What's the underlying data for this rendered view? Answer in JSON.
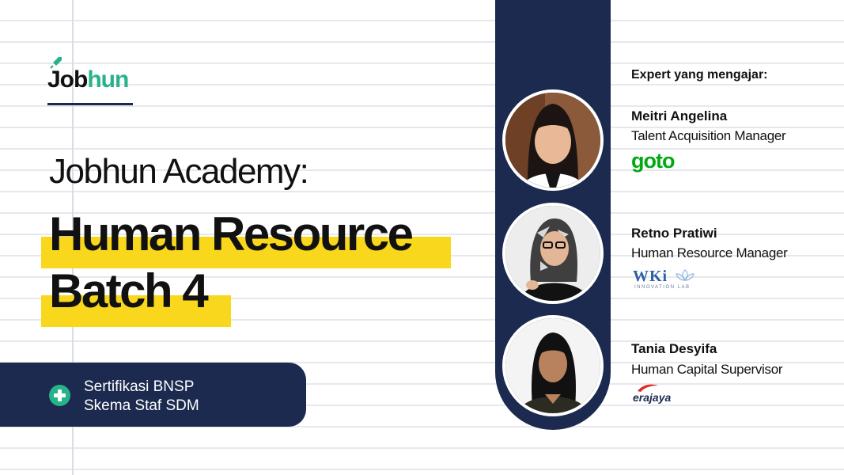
{
  "brand": {
    "logo_job": "Job",
    "logo_hun": "hun"
  },
  "title": {
    "line1": "Jobhun Academy:",
    "line2": "Human Resource",
    "line3": "Batch 4"
  },
  "certification": {
    "icon": "plus-circle-icon",
    "line1": "Sertifikasi BNSP",
    "line2": "Skema Staf SDM"
  },
  "experts": {
    "heading": "Expert yang mengajar:",
    "list": [
      {
        "name": "Meitri Angelina",
        "role": "Talent Acquisition Manager",
        "company_logo": "goto"
      },
      {
        "name": "Retno Pratiwi",
        "role": "Human Resource Manager",
        "company_logo": "WKi",
        "company_logo_sub": "INNOVATION LAB"
      },
      {
        "name": "Tania Desyifa",
        "role": "Human Capital Supervisor",
        "company_logo": "erajaya"
      }
    ]
  },
  "colors": {
    "navy": "#1b2a4e",
    "highlight_yellow": "#f9d71c",
    "brand_green": "#27b38a",
    "goto_green": "#00aa13"
  }
}
